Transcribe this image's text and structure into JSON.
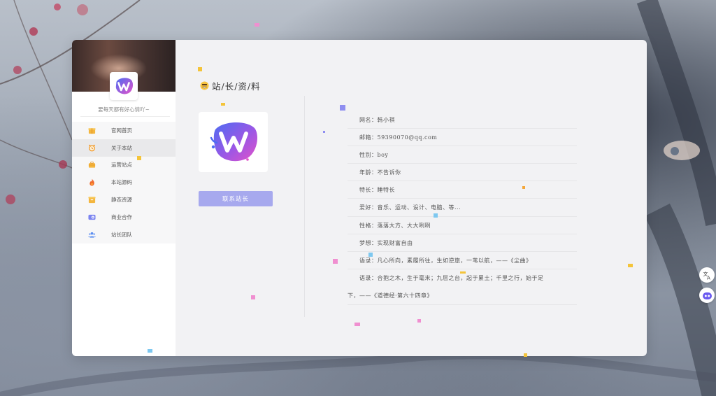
{
  "sidebar": {
    "motto": "要每天都有好心情吖~",
    "items": [
      {
        "label": "官网首页",
        "icon": "gift-icon"
      },
      {
        "label": "关于本站",
        "icon": "clock-icon"
      },
      {
        "label": "运营站点",
        "icon": "briefcase-icon"
      },
      {
        "label": "本站源码",
        "icon": "fire-icon"
      },
      {
        "label": "静态资源",
        "icon": "box-icon"
      },
      {
        "label": "商业合作",
        "icon": "chat-icon"
      },
      {
        "label": "站长团队",
        "icon": "team-icon"
      }
    ],
    "active_index": 1
  },
  "main": {
    "title": "站/长/资/料",
    "contact_button": "联系站长",
    "info": [
      "网名：韩小祺",
      "邮箱：59390070@qq.com",
      "性别：boy",
      "年龄：不告诉你",
      "特长：睡特长",
      "爱好：音乐、运动、设计、电脑、等...",
      "性格：落落大方、大大咧咧",
      "梦想：实现财富自由",
      "语录：凡心所向，素履所往，生如逆旅，一苇以航，——《尘曲》"
    ],
    "quote_line_1": "语录：合抱之木，生于毫末；九层之台，起于累土；千里之行，始于足",
    "quote_line_2": "下，——《道德经·第六十四章》"
  },
  "colors": {
    "accent_button": "#a7a9ee",
    "card_bg": "#f2f2f4",
    "logo_gradient_start": "#4d6cf2",
    "logo_gradient_end": "#e252c9"
  }
}
